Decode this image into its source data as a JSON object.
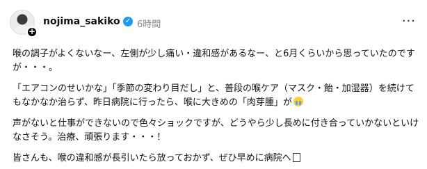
{
  "post": {
    "username": "nojima_sakiko",
    "time": "6時間",
    "paragraphs": [
      "喉の調子がよくないなー、左側が少し痛い・違和感があるなー、と6月くらいから思っていたのですが・・・。",
      "「エアコンのせいかな」「季節の変わり目だし」と、普段の喉ケア（マスク・飴・加湿器）を続けてもなかなか治らず、昨日病院に行ったら、喉に大きめの「肉芽腫」が",
      "声がないと仕事ができないので色々ショックですが、どうやら少し長めに付き合っていかないといけなさそう。治療、頑張ります・・・！",
      "皆さんも、喉の違和感が長引いたら放っておかず、ぜひ早めに病院へ"
    ]
  },
  "icons": {
    "verified": "verified-badge-icon",
    "more": "more-options-icon",
    "follow": "plus-icon",
    "crying": "crying-face-emoji",
    "missing": "unknown-glyph"
  }
}
